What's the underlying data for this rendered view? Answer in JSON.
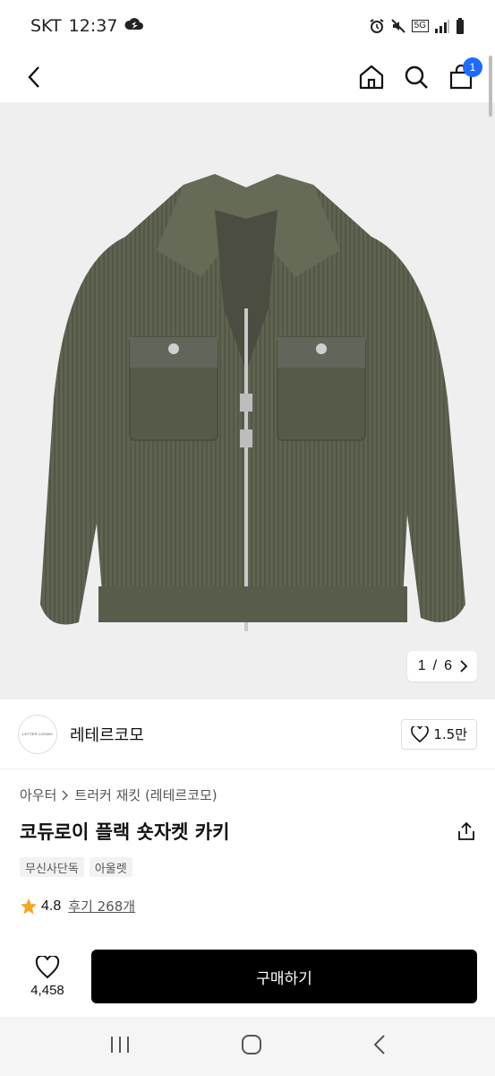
{
  "status": {
    "carrier": "SKT",
    "time": "12:37",
    "network": "5G"
  },
  "header": {
    "cart_count": "1"
  },
  "gallery": {
    "current": "1",
    "separator": "/",
    "total": "6"
  },
  "brand": {
    "logo_text": "LETTER COSMO",
    "name": "레테르코모",
    "likes": "1.5만"
  },
  "breadcrumb": {
    "category": "아우터",
    "subcategory": "트러커 재킷 (레테르코모)"
  },
  "product": {
    "title": "코듀로이 플랙 숏자켓 카키"
  },
  "tags": [
    "무신사단독",
    "아울렛"
  ],
  "rating": {
    "score": "4.8",
    "reviews": "후기 268개"
  },
  "actions": {
    "wish_count": "4,458",
    "buy_label": "구매하기"
  },
  "colors": {
    "accent": "#1e6bff",
    "star": "#f5a623",
    "jacket": "#5f6452",
    "hero_bg": "#efefef"
  }
}
